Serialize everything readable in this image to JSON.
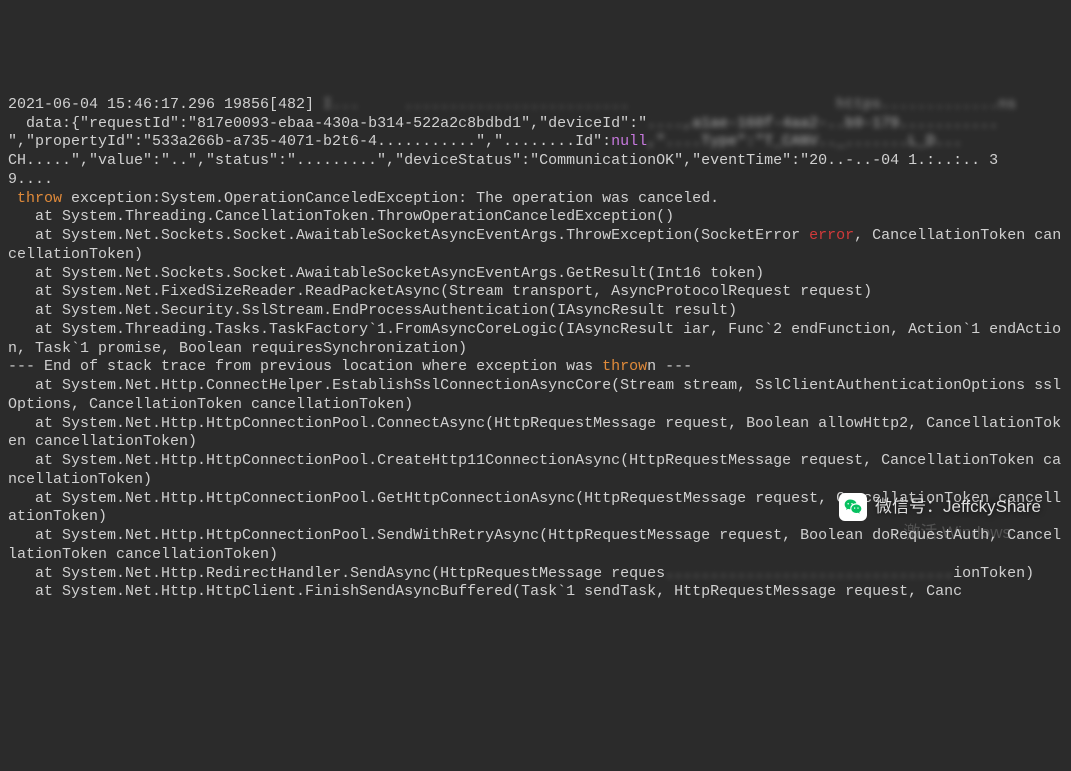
{
  "header": {
    "line0_prefix": "                                                                    ",
    "line0_blur": "                                                  ",
    "timestamp": "2021-06-04 15:46:17.296 19856[482] ",
    "blur_a": "I...     .........................                       https.............ns"
  },
  "json_payload": {
    "line1_a": "  data:{\"requestId\":\"817e0093-ebaa-430a-b314-522a2c8bdbd1\",\"deviceId\":\"",
    "line1_blur": "....,a1ae-160f-4aa2-..b9-179...........",
    "line2_a": "\",\"propertyId\":\"533a266b-a735-4071-b2t6-4...........\",\"........Id\":",
    "line2_null": "null",
    "line2_b": ",\"....Type\":\"T_CANV.._.......L_D...",
    "line3_a": "CH.....\",\"value\":\"..\",\"status\":\".........\",\"deviceStatus\":\"CommunicationOK\",\"eventTime\":\"20..-..-04 1.:..:.. 3",
    "line4_a": "9...."
  },
  "stack": {
    "throw_kw": "throw",
    "throw_rest": " exception:System.OperationCanceledException: The operation was canceled.",
    "at1": "   at System.Threading.CancellationToken.ThrowOperationCanceledException()",
    "at2a": "   at System.Net.Sockets.Socket.AwaitableSocketAsyncEventArgs.ThrowException(SocketError ",
    "error_kw": "error",
    "at2b": ", CancellationToken cancellationToken)",
    "at3": "   at System.Net.Sockets.Socket.AwaitableSocketAsyncEventArgs.GetResult(Int16 token)",
    "at4": "   at System.Net.FixedSizeReader.ReadPacketAsync(Stream transport, AsyncProtocolRequest request)",
    "at5": "   at System.Net.Security.SslStream.EndProcessAuthentication(IAsyncResult result)",
    "at6": "   at System.Threading.Tasks.TaskFactory`1.FromAsyncCoreLogic(IAsyncResult iar, Func`2 endFunction, Action`1 endAction, Task`1 promise, Boolean requiresSynchronization)",
    "end_a": "--- End of stack trace from previous location where exception was ",
    "end_throw": "throw",
    "end_b": "n ---",
    "at7": "   at System.Net.Http.ConnectHelper.EstablishSslConnectionAsyncCore(Stream stream, SslClientAuthenticationOptions sslOptions, CancellationToken cancellationToken)",
    "at8": "   at System.Net.Http.HttpConnectionPool.ConnectAsync(HttpRequestMessage request, Boolean allowHttp2, CancellationToken cancellationToken)",
    "at9": "   at System.Net.Http.HttpConnectionPool.CreateHttp11ConnectionAsync(HttpRequestMessage request, CancellationToken cancellationToken)",
    "at10": "   at System.Net.Http.HttpConnectionPool.GetHttpConnectionAsync(HttpRequestMessage request, CancellationToken cancellationToken)",
    "at11": "   at System.Net.Http.HttpConnectionPool.SendWithRetryAsync(HttpRequestMessage request, Boolean doRequestAuth, CancellationToken cancellationToken)",
    "at12a": "   at System.Net.Http.RedirectHandler.SendAsync(HttpRequestMessage reques",
    "at12_blur": "................................",
    "at12b": "ionToken)",
    "at13": "   at System.Net.Http.HttpClient.FinishSendAsyncBuffered(Task`1 sendTask, HttpRequestMessage request, Canc"
  },
  "watermark": {
    "label": "微信号：JeffckyShare"
  },
  "activate": {
    "text": "激活 Windows"
  }
}
